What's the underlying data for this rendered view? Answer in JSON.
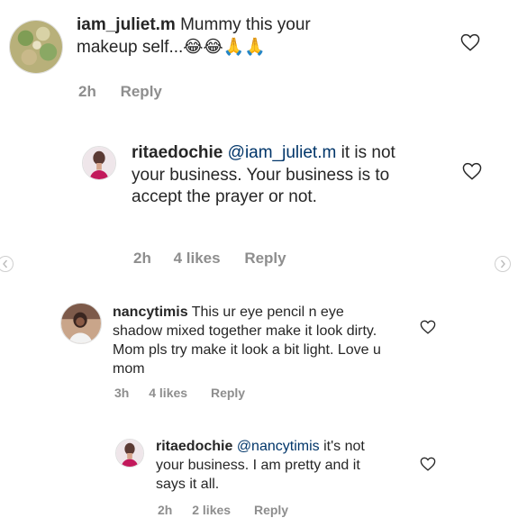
{
  "comments": [
    {
      "username": "iam_juliet.m",
      "text": "Mummy this your makeup self...😂😂🙏🙏",
      "time": "2h",
      "reply": "Reply"
    },
    {
      "username": "ritaedochie",
      "mention": "@iam_juliet.m",
      "text": "it is not your business. Your business is to accept the prayer or not.",
      "time": "2h",
      "likes": "4 likes",
      "reply": "Reply"
    },
    {
      "username": "nancytimis",
      "text": "This ur eye pencil n eye shadow mixed together make it look dirty. Mom pls try make it look a bit light. Love u mom",
      "time": "3h",
      "likes": "4 likes",
      "reply": "Reply"
    },
    {
      "username": "ritaedochie",
      "mention": "@nancytimis",
      "text": "it's not your business.  I am pretty and it says it all.",
      "time": "2h",
      "likes": "2 likes",
      "reply": "Reply"
    }
  ],
  "icons": {
    "like": "heart-outline-icon",
    "prev": "chevron-left-icon",
    "next": "chevron-right-icon"
  },
  "colors": {
    "text": "#262626",
    "muted": "#8e8e8e",
    "mention": "#003569"
  }
}
